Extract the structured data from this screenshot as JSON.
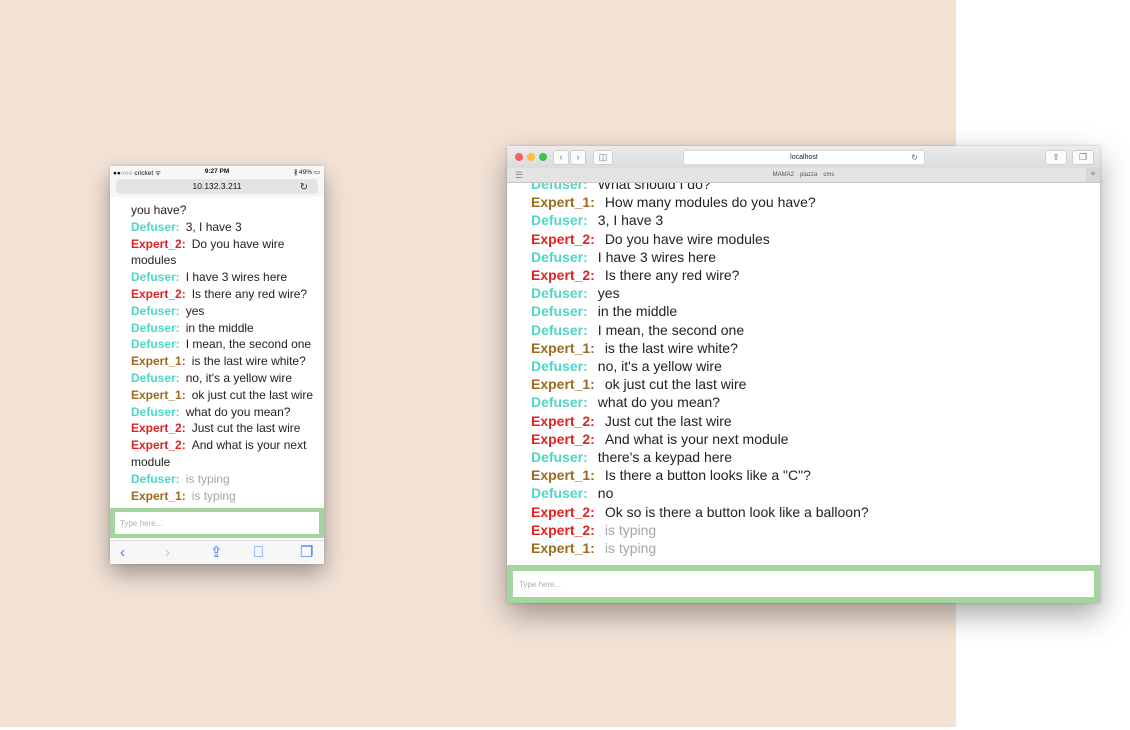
{
  "phone": {
    "status": {
      "carrier": "●●○○○ cricket ᯤ",
      "time": "9:27 PM",
      "battery": "∦ 49% ▭"
    },
    "address": "10.132.3.211",
    "reload_icon": "reload-icon",
    "messages": [
      {
        "speaker": "",
        "text": "you have?",
        "role": "cont"
      },
      {
        "speaker": "Defuser:",
        "text": "3, I have 3",
        "role": "defuser"
      },
      {
        "speaker": "Expert_2:",
        "text": "Do you have wire modules",
        "role": "expert2"
      },
      {
        "speaker": "Defuser:",
        "text": "I have 3 wires here",
        "role": "defuser"
      },
      {
        "speaker": "Expert_2:",
        "text": "Is there any red wire?",
        "role": "expert2"
      },
      {
        "speaker": "Defuser:",
        "text": "yes",
        "role": "defuser"
      },
      {
        "speaker": "Defuser:",
        "text": "in the middle",
        "role": "defuser"
      },
      {
        "speaker": "Defuser:",
        "text": "I mean, the second one",
        "role": "defuser"
      },
      {
        "speaker": "Expert_1:",
        "text": "is the last wire white?",
        "role": "expert1"
      },
      {
        "speaker": "Defuser:",
        "text": "no, it's a yellow wire",
        "role": "defuser"
      },
      {
        "speaker": "Expert_1:",
        "text": "ok just cut the last wire",
        "role": "expert1"
      },
      {
        "speaker": "Defuser:",
        "text": "what do you mean?",
        "role": "defuser"
      },
      {
        "speaker": "Expert_2:",
        "text": "Just cut the last wire",
        "role": "expert2"
      },
      {
        "speaker": "Expert_2:",
        "text": "And what is your next module",
        "role": "expert2"
      },
      {
        "speaker": "Defuser:",
        "text": "is typing",
        "role": "defuser",
        "typing": true
      },
      {
        "speaker": "Expert_1:",
        "text": "is typing",
        "role": "expert1",
        "typing": true
      }
    ],
    "input_placeholder": "Type here...",
    "toolbar": [
      {
        "glyph": "‹",
        "icon": "back-icon",
        "color": "#3478f6"
      },
      {
        "glyph": "›",
        "icon": "forward-icon",
        "color": "#c7c7cc"
      },
      {
        "glyph": "⇪",
        "icon": "share-icon",
        "color": "#3478f6"
      },
      {
        "glyph": "⎕",
        "icon": "bookmarks-icon",
        "color": "#3478f6"
      },
      {
        "glyph": "❐",
        "icon": "tabs-icon",
        "color": "#3478f6"
      }
    ]
  },
  "desktop": {
    "address": "localhost",
    "favorites": [
      "MAMA2",
      "piazza",
      "cms"
    ],
    "messages": [
      {
        "speaker": "Defuser:",
        "text": "What should I do?",
        "role": "defuser"
      },
      {
        "speaker": "Expert_1:",
        "text": "How many modules do you have?",
        "role": "expert1"
      },
      {
        "speaker": "Defuser:",
        "text": "3, I have 3",
        "role": "defuser"
      },
      {
        "speaker": "Expert_2:",
        "text": "Do you have wire modules",
        "role": "expert2"
      },
      {
        "speaker": "Defuser:",
        "text": "I have 3 wires here",
        "role": "defuser"
      },
      {
        "speaker": "Expert_2:",
        "text": "Is there any red wire?",
        "role": "expert2"
      },
      {
        "speaker": "Defuser:",
        "text": "yes",
        "role": "defuser"
      },
      {
        "speaker": "Defuser:",
        "text": "in the middle",
        "role": "defuser"
      },
      {
        "speaker": "Defuser:",
        "text": "I mean, the second one",
        "role": "defuser"
      },
      {
        "speaker": "Expert_1:",
        "text": "is the last wire white?",
        "role": "expert1"
      },
      {
        "speaker": "Defuser:",
        "text": "no, it's a yellow wire",
        "role": "defuser"
      },
      {
        "speaker": "Expert_1:",
        "text": "ok just cut the last wire",
        "role": "expert1"
      },
      {
        "speaker": "Defuser:",
        "text": "what do you mean?",
        "role": "defuser"
      },
      {
        "speaker": "Expert_2:",
        "text": "Just cut the last wire",
        "role": "expert2"
      },
      {
        "speaker": "Expert_2:",
        "text": "And what is your next module",
        "role": "expert2"
      },
      {
        "speaker": "Defuser:",
        "text": "there's a keypad here",
        "role": "defuser"
      },
      {
        "speaker": "Expert_1:",
        "text": "Is there a button looks like a \"C\"?",
        "role": "expert1"
      },
      {
        "speaker": "Defuser:",
        "text": "no",
        "role": "defuser"
      },
      {
        "speaker": "Expert_2:",
        "text": "Ok so is there a button look like a balloon?",
        "role": "expert2"
      },
      {
        "speaker": "Expert_2:",
        "text": "is typing",
        "role": "expert2",
        "typing": true
      },
      {
        "speaker": "Expert_1:",
        "text": "is typing",
        "role": "expert1",
        "typing": true
      }
    ],
    "input_placeholder": "Type here..."
  },
  "colors": {
    "backdrop": "#f3e3d7",
    "defuser": "#4fd6c6",
    "expert_1": "#9c6a1e",
    "expert_2": "#e12222",
    "input_border": "#a5d59e",
    "typing": "#a6a6a6"
  }
}
